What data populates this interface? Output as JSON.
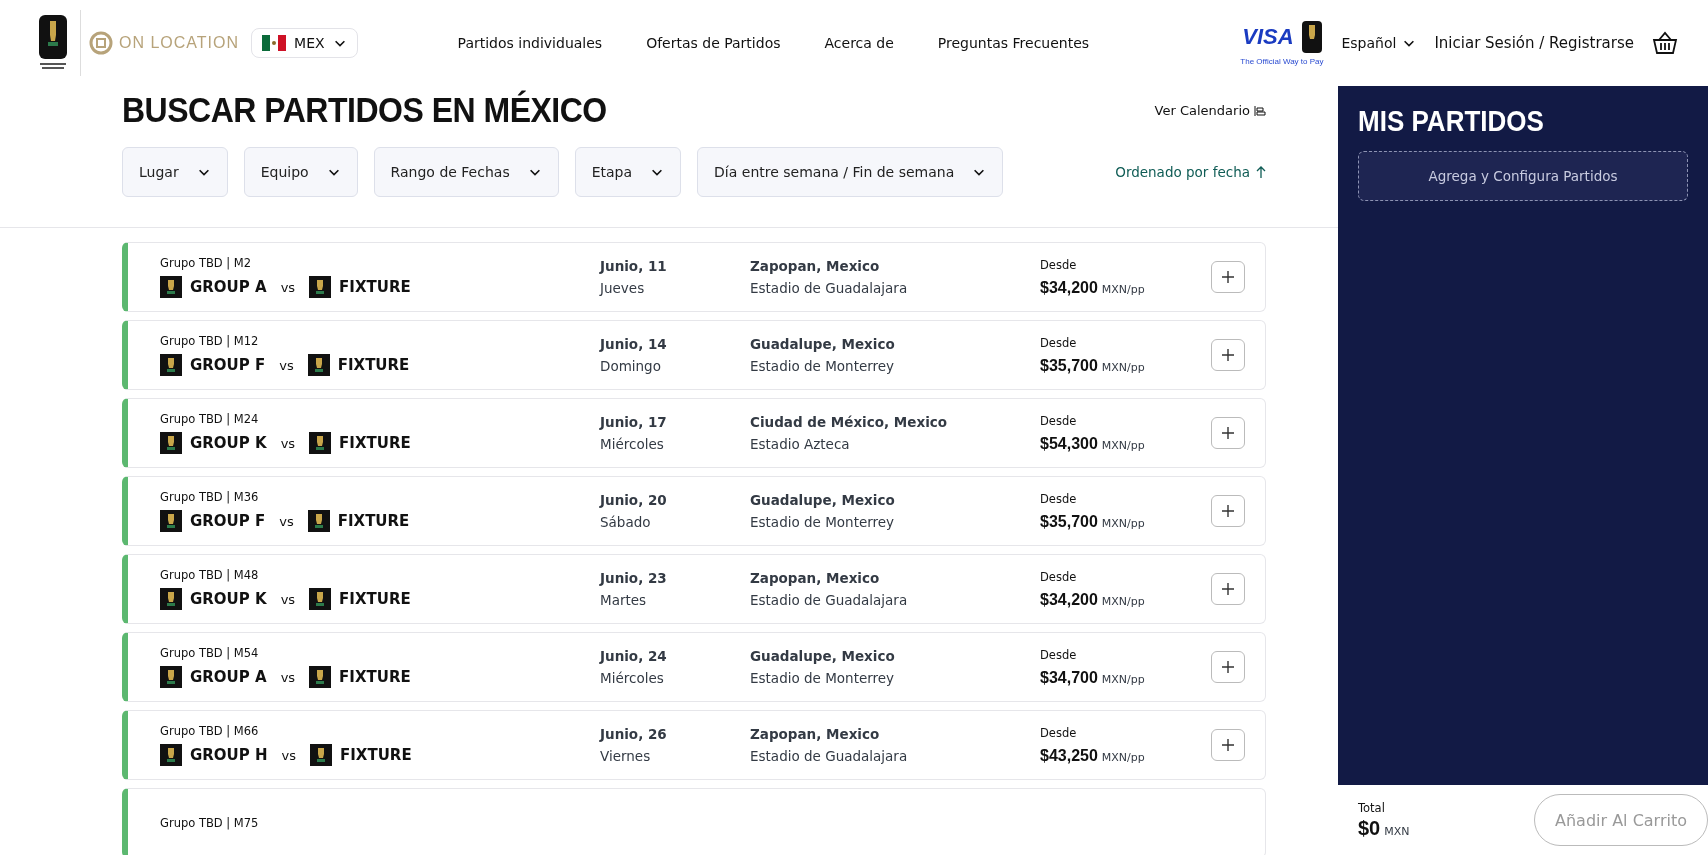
{
  "header": {
    "brand": "ON LOCATION",
    "country": "MEX",
    "nav": [
      "Partidos individuales",
      "Ofertas de Partidos",
      "Acerca de",
      "Preguntas Frecuentes"
    ],
    "sponsor": "VISA",
    "sponsor_tagline": "The Official Way to Pay",
    "language": "Español",
    "login": "Iniciar Sesión / Registrarse"
  },
  "search": {
    "title": "BUSCAR PARTIDOS EN MÉXICO",
    "calendar_link": "Ver Calendario",
    "filters": [
      "Lugar",
      "Equipo",
      "Rango de Fechas",
      "Etapa",
      "Día entre semana / Fin de semana"
    ],
    "sort": "Ordenado por fecha"
  },
  "matches": [
    {
      "label": "Grupo TBD | M2",
      "home": "GROUP A",
      "vs": "vs",
      "away": "FIXTURE",
      "date": "Junio, 11",
      "day": "Jueves",
      "city": "Zapopan, Mexico",
      "stadium": "Estadio de Guadalajara",
      "from": "Desde",
      "price": "$34,200",
      "unit": "MXN/pp"
    },
    {
      "label": "Grupo TBD | M12",
      "home": "GROUP F",
      "vs": "vs",
      "away": "FIXTURE",
      "date": "Junio, 14",
      "day": "Domingo",
      "city": "Guadalupe, Mexico",
      "stadium": "Estadio de Monterrey",
      "from": "Desde",
      "price": "$35,700",
      "unit": "MXN/pp"
    },
    {
      "label": "Grupo TBD | M24",
      "home": "GROUP K",
      "vs": "vs",
      "away": "FIXTURE",
      "date": "Junio, 17",
      "day": "Miércoles",
      "city": "Ciudad de México, Mexico",
      "stadium": "Estadio Azteca",
      "from": "Desde",
      "price": "$54,300",
      "unit": "MXN/pp"
    },
    {
      "label": "Grupo TBD | M36",
      "home": "GROUP F",
      "vs": "vs",
      "away": "FIXTURE",
      "date": "Junio, 20",
      "day": "Sábado",
      "city": "Guadalupe, Mexico",
      "stadium": "Estadio de Monterrey",
      "from": "Desde",
      "price": "$35,700",
      "unit": "MXN/pp"
    },
    {
      "label": "Grupo TBD | M48",
      "home": "GROUP K",
      "vs": "vs",
      "away": "FIXTURE",
      "date": "Junio, 23",
      "day": "Martes",
      "city": "Zapopan, Mexico",
      "stadium": "Estadio de Guadalajara",
      "from": "Desde",
      "price": "$34,200",
      "unit": "MXN/pp"
    },
    {
      "label": "Grupo TBD | M54",
      "home": "GROUP A",
      "vs": "vs",
      "away": "FIXTURE",
      "date": "Junio, 24",
      "day": "Miércoles",
      "city": "Guadalupe, Mexico",
      "stadium": "Estadio de Monterrey",
      "from": "Desde",
      "price": "$34,700",
      "unit": "MXN/pp"
    },
    {
      "label": "Grupo TBD | M66",
      "home": "GROUP H",
      "vs": "vs",
      "away": "FIXTURE",
      "date": "Junio, 26",
      "day": "Viernes",
      "city": "Zapopan, Mexico",
      "stadium": "Estadio de Guadalajara",
      "from": "Desde",
      "price": "$43,250",
      "unit": "MXN/pp"
    },
    {
      "label": "Grupo TBD | M75"
    }
  ],
  "my_matches": {
    "title": "MIS PARTIDOS",
    "add": "Agrega y Configura Partidos",
    "total_label": "Total",
    "total": "$0",
    "currency": "MXN",
    "cart_button": "Añadir Al Carrito",
    "cart_disabled": true
  }
}
